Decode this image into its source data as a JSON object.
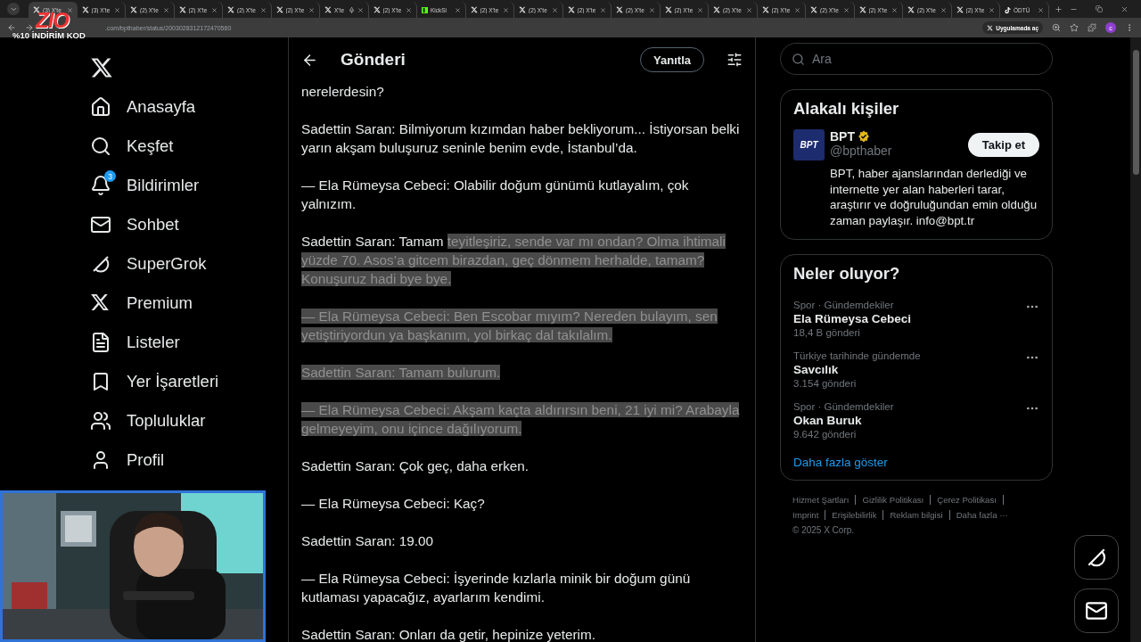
{
  "browser": {
    "tabs": [
      {
        "label": "(3) X'te",
        "kind": "x",
        "selected": true,
        "audio": false
      },
      {
        "label": "(3) X'te",
        "kind": "x",
        "selected": false,
        "audio": false
      },
      {
        "label": "(2) X'te",
        "kind": "x",
        "selected": false,
        "audio": false
      },
      {
        "label": "(2) X'te",
        "kind": "x",
        "selected": false,
        "audio": false
      },
      {
        "label": "(2) X'te",
        "kind": "x",
        "selected": false,
        "audio": false
      },
      {
        "label": "(2) X'te",
        "kind": "x",
        "selected": false,
        "audio": false
      },
      {
        "label": "X'te",
        "kind": "x",
        "selected": false,
        "audio": true
      },
      {
        "label": "(2) X'te",
        "kind": "x",
        "selected": false,
        "audio": false
      },
      {
        "label": "KickSi",
        "kind": "kick",
        "selected": false,
        "audio": false
      },
      {
        "label": "(2) X'te",
        "kind": "x",
        "selected": false,
        "audio": false
      },
      {
        "label": "(2) X'te",
        "kind": "x",
        "selected": false,
        "audio": false
      },
      {
        "label": "(2) X'te",
        "kind": "x",
        "selected": false,
        "audio": false
      },
      {
        "label": "(2) X'te",
        "kind": "x",
        "selected": false,
        "audio": false
      },
      {
        "label": "(2) X'te",
        "kind": "x",
        "selected": false,
        "audio": false
      },
      {
        "label": "(2) X'te",
        "kind": "x",
        "selected": false,
        "audio": false
      },
      {
        "label": "(2) X'te",
        "kind": "x",
        "selected": false,
        "audio": false
      },
      {
        "label": "(2) X'te",
        "kind": "x",
        "selected": false,
        "audio": false
      },
      {
        "label": "(2) X'te",
        "kind": "x",
        "selected": false,
        "audio": false
      },
      {
        "label": "(2) X'te",
        "kind": "x",
        "selected": false,
        "audio": false
      },
      {
        "label": "(2) X'te",
        "kind": "x",
        "selected": false,
        "audio": false
      },
      {
        "label": "ÖDTÜ",
        "kind": "tiktok",
        "selected": false,
        "audio": false
      }
    ],
    "address": ".com/bpthaber/status/2003028312172470560",
    "open_in_app": "Uygulamada aç",
    "profile_initial": "c"
  },
  "stream_overlay": {
    "logo": "ZIO",
    "promo": "%10 İNDİRİM KOD"
  },
  "sidebar": {
    "items": [
      {
        "label": "Anasayfa"
      },
      {
        "label": "Keşfet"
      },
      {
        "label": "Bildirimler",
        "badge": "3"
      },
      {
        "label": "Sohbet"
      },
      {
        "label": "SuperGrok"
      },
      {
        "label": "Premium"
      },
      {
        "label": "Listeler"
      },
      {
        "label": "Yer İşaretleri"
      },
      {
        "label": "Topluluklar"
      },
      {
        "label": "Profil"
      }
    ]
  },
  "post": {
    "title": "Gönderi",
    "reply_button": "Yanıtla",
    "paragraphs": [
      {
        "segments": [
          {
            "text": "nerelerdesin?",
            "selected": false
          }
        ]
      },
      {
        "segments": [
          {
            "text": "Sadettin Saran: Bilmiyorum kızımdan haber bekliyorum... İstiyorsan belki yarın akşam buluşuruz seninle benim evde, İstanbul’da.",
            "selected": false
          }
        ]
      },
      {
        "segments": [
          {
            "text": "— Ela Rümeysa Cebeci: Olabilir doğum günümü kutlayalım, çok yalnızım.",
            "selected": false
          }
        ]
      },
      {
        "segments": [
          {
            "text": "Sadettin Saran: Tamam ",
            "selected": false
          },
          {
            "text": "teyitleşiriz, sende var mı ondan? Olma ihtimali yüzde 70. Asos’a gitcem birazdan, geç dönmem herhalde, tamam? Konuşuruz hadi bye bye.",
            "selected": true
          }
        ]
      },
      {
        "segments": [
          {
            "text": "— Ela Rümeysa Cebeci: Ben Escobar mıyım? Nereden bulayım, sen yetiştiriyordun ya başkanım, yol birkaç dal takılalım.",
            "selected": true
          }
        ]
      },
      {
        "segments": [
          {
            "text": "Sadettin Saran: Tamam bulurum.",
            "selected": true
          }
        ]
      },
      {
        "segments": [
          {
            "text": "— Ela Rümeysa Cebeci: Akşam kaçta aldırırsın beni, 21 iyi mi? Arabayla gelmeyeyim, onu içince dağılıyorum.",
            "selected": true
          }
        ]
      },
      {
        "segments": [
          {
            "text": "Sadettin Saran: Çok geç, daha erken.",
            "selected": false
          }
        ]
      },
      {
        "segments": [
          {
            "text": "— Ela Rümeysa Cebeci: Kaç?",
            "selected": false
          }
        ]
      },
      {
        "segments": [
          {
            "text": "Sadettin Saran: 19.00",
            "selected": false
          }
        ]
      },
      {
        "segments": [
          {
            "text": "— Ela Rümeysa Cebeci: İşyerinde kızlarla minik bir doğum günü kutlaması yapacağız, ayarlarım kendimi.",
            "selected": false
          }
        ]
      },
      {
        "segments": [
          {
            "text": "Sadettin Saran: Onları da getir, hepinize yeterim.",
            "selected": false
          }
        ]
      }
    ]
  },
  "search": {
    "placeholder": "Ara"
  },
  "related": {
    "title": "Alakalı kişiler",
    "account": {
      "avatar_label": "BPT",
      "name": "BPT",
      "verified": true,
      "handle": "@bpthaber",
      "follow_button": "Takip et",
      "bio": "BPT, haber ajanslarından derlediği ve internette yer alan haberleri tarar, araştırır ve doğruluğundan emin olduğu zaman paylaşır. info@bpt.tr"
    }
  },
  "trends": {
    "title": "Neler oluyor?",
    "items": [
      {
        "category": "Spor · Gündemdekiler",
        "name": "Ela Rümeysa Cebeci",
        "count": "18,4 B gönderi"
      },
      {
        "category": "Türkiye tarihinde gündemde",
        "name": "Savcılık",
        "count": "3.154 gönderi"
      },
      {
        "category": "Spor · Gündemdekiler",
        "name": "Okan Buruk",
        "count": "9.642 gönderi"
      }
    ],
    "show_more": "Daha fazla göster"
  },
  "footer": {
    "links": [
      "Hizmet Şartları",
      "Gizlilik Politikası",
      "Çerez Politikası",
      "Imprint",
      "Erişilebilirlik",
      "Reklam bilgisi",
      "Daha fazla ···"
    ],
    "copyright": "© 2025 X Corp."
  }
}
